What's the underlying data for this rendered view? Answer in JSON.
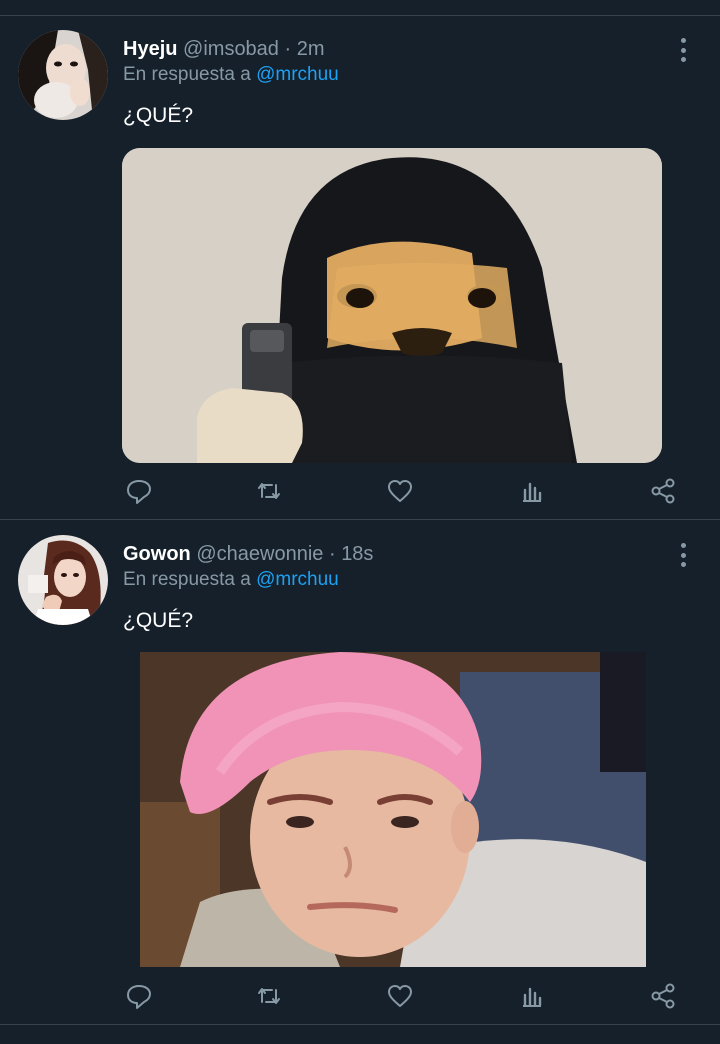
{
  "tweets": [
    {
      "name": "Hyeju",
      "handle": "@imsobad",
      "sep": "·",
      "time": "2m",
      "reply_prefix": "En respuesta a",
      "reply_to": "@mrchuu",
      "text": "¿QUÉ?",
      "avatar_icon": "user-avatar",
      "media_description_icon": "image"
    },
    {
      "name": "Gowon",
      "handle": "@chaewonnie",
      "sep": "·",
      "time": "18s",
      "reply_prefix": "En respuesta a",
      "reply_to": "@mrchuu",
      "text": "¿QUÉ?",
      "avatar_icon": "user-avatar",
      "media_description_icon": "image"
    }
  ],
  "actions": [
    "reply-icon",
    "retweet-icon",
    "like-icon",
    "analytics-icon",
    "share-icon"
  ],
  "colors": {
    "background": "#15202b",
    "divider": "#38444d",
    "secondary_text": "#8899a6",
    "link": "#1da1f2"
  }
}
